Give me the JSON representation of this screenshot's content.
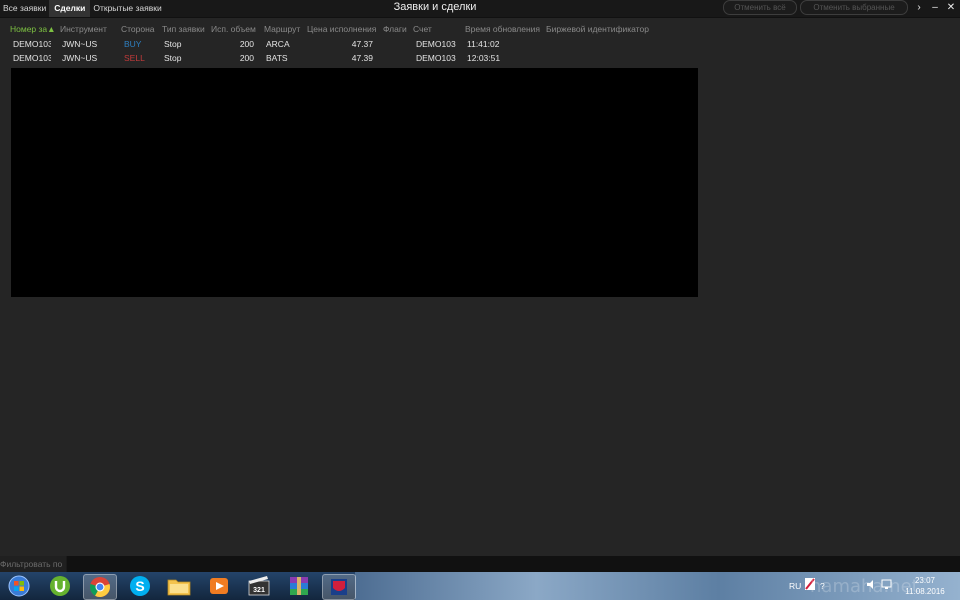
{
  "window": {
    "title": "Заявки и сделки",
    "tabs": [
      "Все заявки",
      "Сделки",
      "Открытые заявки"
    ],
    "active_tab": "Сделки",
    "cancel_all_label": "Отменить всё",
    "cancel_selected_label": "Отменить выбранные",
    "controls": {
      "more": "›",
      "minimize": "–",
      "close": "✕"
    }
  },
  "table": {
    "columns": [
      "Номер за",
      "Инструмент",
      "Сторона",
      "Тип заявки",
      "Исп. объем",
      "Маршрут",
      "Цена исполнения",
      "Флаги",
      "Счет",
      "Время обновления",
      "Биржевой идентификатор"
    ],
    "sorted_column_marker": "▲",
    "rows": [
      {
        "order_no": "DEMO103",
        "instrument": "JWN~US",
        "side": "BUY",
        "type": "Stop",
        "filled_qty": "200",
        "route": "ARCA",
        "price": "47.37",
        "flags": "",
        "account": "DEMO103",
        "time": "11:41:02",
        "exchange_id": ""
      },
      {
        "order_no": "DEMO103",
        "instrument": "JWN~US",
        "side": "SELL",
        "type": "Stop",
        "filled_qty": "200",
        "route": "BATS",
        "price": "47.39",
        "flags": "",
        "account": "DEMO103",
        "time": "12:03:51",
        "exchange_id": ""
      }
    ]
  },
  "filter": {
    "label": "Фильтровать по",
    "value": ""
  },
  "taskbar": {
    "lang": "RU",
    "time": "23:07",
    "date": "11.08.2016",
    "watermark": "hamaha.net",
    "colors": {
      "start": "#3a7bd5",
      "utorrent": "#66b22f",
      "chrome_red": "#db4437",
      "skype": "#00aff0",
      "folder": "#f3c34e",
      "media": "#f07c22",
      "winrar": "#8a3bb0"
    }
  }
}
